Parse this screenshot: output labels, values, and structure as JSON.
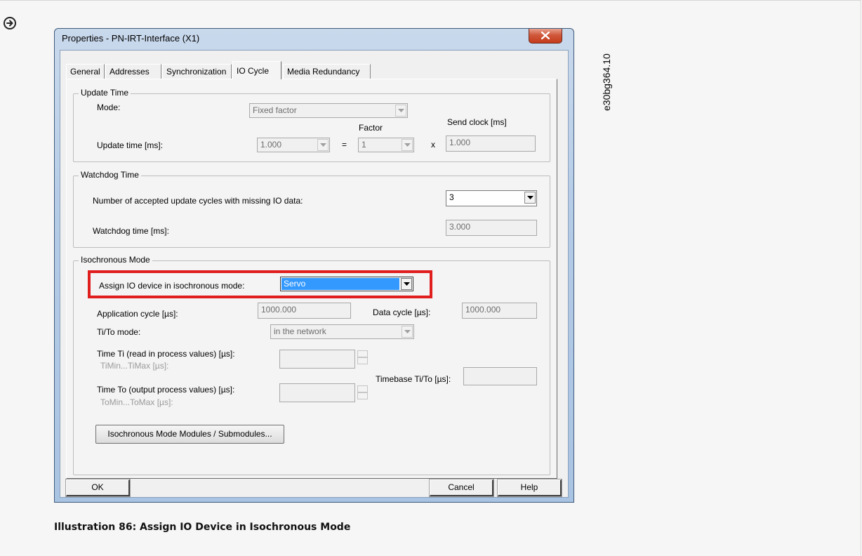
{
  "figure_code": "e30bg364.10",
  "caption": "Illustration 86: Assign IO Device in Isochronous Mode",
  "window": {
    "title": "Properties - PN-IRT-Interface (X1)",
    "tabs": [
      "General",
      "Addresses",
      "Synchronization",
      "IO Cycle",
      "Media Redundancy"
    ],
    "active_tab": "IO Cycle"
  },
  "update_time": {
    "group_title": "Update Time",
    "mode_label": "Mode:",
    "mode_value": "Fixed factor",
    "factor_label": "Factor",
    "send_clock_label": "Send clock [ms]",
    "update_time_label": "Update time [ms]:",
    "update_time_value": "1.000",
    "equals": "=",
    "factor_value": "1",
    "times": "x",
    "send_clock_value": "1.000"
  },
  "watchdog": {
    "group_title": "Watchdog Time",
    "cycles_label": "Number of accepted update cycles with missing IO data:",
    "cycles_value": "3",
    "time_label": "Watchdog time [ms]:",
    "time_value": "3.000"
  },
  "isochronous": {
    "group_title": "Isochronous Mode",
    "assign_label": "Assign IO device in isochronous mode:",
    "assign_value": "Servo",
    "app_cycle_label": "Application cycle [µs]:",
    "app_cycle_value": "1000.000",
    "data_cycle_label": "Data cycle [µs]:",
    "data_cycle_value": "1000.000",
    "tito_mode_label": "Ti/To mode:",
    "tito_mode_value": "in the network",
    "ti_label": "Time Ti (read in process values) [µs]:",
    "ti_range_label": "TiMin...TiMax [µs]:",
    "to_label": "Time To (output process values) [µs]:",
    "to_range_label": "ToMin...ToMax [µs]:",
    "timebase_label": "Timebase Ti/To [µs]:",
    "modules_button": "Isochronous Mode Modules / Submodules..."
  },
  "buttons": {
    "ok": "OK",
    "cancel": "Cancel",
    "help": "Help"
  },
  "colors": {
    "highlight": "#e01e1e",
    "selection": "#3399ff"
  }
}
